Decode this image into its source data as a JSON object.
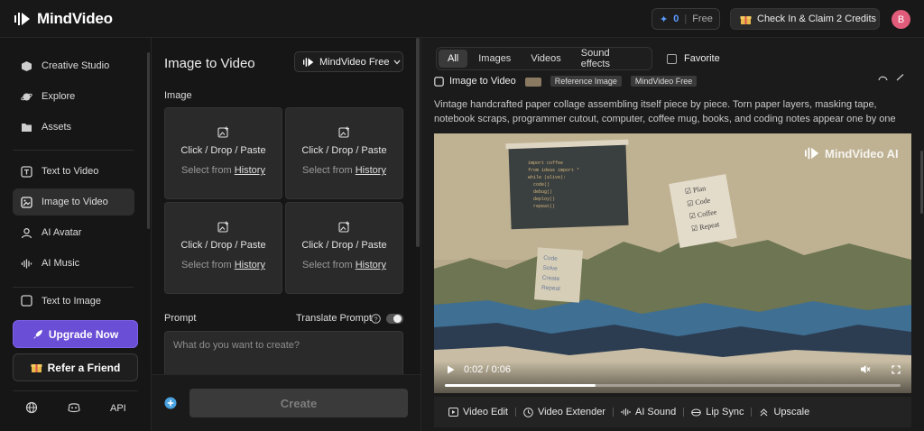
{
  "header": {
    "app_name": "MindVideo",
    "credits": {
      "count": "0",
      "plan": "Free"
    },
    "checkin_label": "Check In & Claim 2 Credits",
    "avatar_initial": "B"
  },
  "sidebar": {
    "items": [
      {
        "label": "Creative Studio",
        "icon": "cube-icon"
      },
      {
        "label": "Explore",
        "icon": "planet-icon"
      },
      {
        "label": "Assets",
        "icon": "folder-icon"
      },
      {
        "label": "Text to Video",
        "icon": "text-video-icon"
      },
      {
        "label": "Image to Video",
        "icon": "image-video-icon",
        "active": true
      },
      {
        "label": "AI Avatar",
        "icon": "avatar-icon"
      },
      {
        "label": "AI Music",
        "icon": "waveform-icon"
      },
      {
        "label": "Text to Image",
        "icon": "text-image-icon"
      }
    ],
    "upgrade_label": "Upgrade Now",
    "refer_label": "Refer a Friend",
    "api_label": "API"
  },
  "center": {
    "title": "Image to Video",
    "model": "MindVideo Free",
    "image_label": "Image",
    "dropzone_main": "Click / Drop / Paste",
    "dropzone_sub_prefix": "Select from ",
    "dropzone_sub_link": "History",
    "prompt_label": "Prompt",
    "translate_label": "Translate Prompt",
    "prompt_placeholder": "What do you want to create?",
    "create_label": "Create"
  },
  "right": {
    "tabs": [
      "All",
      "Images",
      "Videos",
      "Sound effects"
    ],
    "active_tab": "All",
    "favorite_label": "Favorite",
    "item_type": "Image to Video",
    "reference_label": "Reference Image",
    "model_chip": "MindVideo Free",
    "description": "Vintage handcrafted paper collage assembling itself piece by piece. Torn paper layers, masking tape, notebook scraps, programmer cutout, computer, coffee mug, books, and coding notes appear one by one with realistic ...",
    "watermark": "MindVideo AI",
    "video_time": "0:02 / 0:06",
    "video_progress": 0.33,
    "tools": [
      {
        "label": "Video Edit",
        "icon": "video-edit-icon"
      },
      {
        "label": "Video Extender",
        "icon": "clock-icon"
      },
      {
        "label": "AI Sound",
        "icon": "sound-wave-icon"
      },
      {
        "label": "Lip Sync",
        "icon": "lips-icon"
      },
      {
        "label": "Upscale",
        "icon": "upscale-icon"
      }
    ]
  },
  "colors": {
    "accent_purple": "#6a4ed6",
    "credit_blue": "#5b9cff",
    "avatar_pink": "#e05c7a",
    "background": "#161616"
  }
}
